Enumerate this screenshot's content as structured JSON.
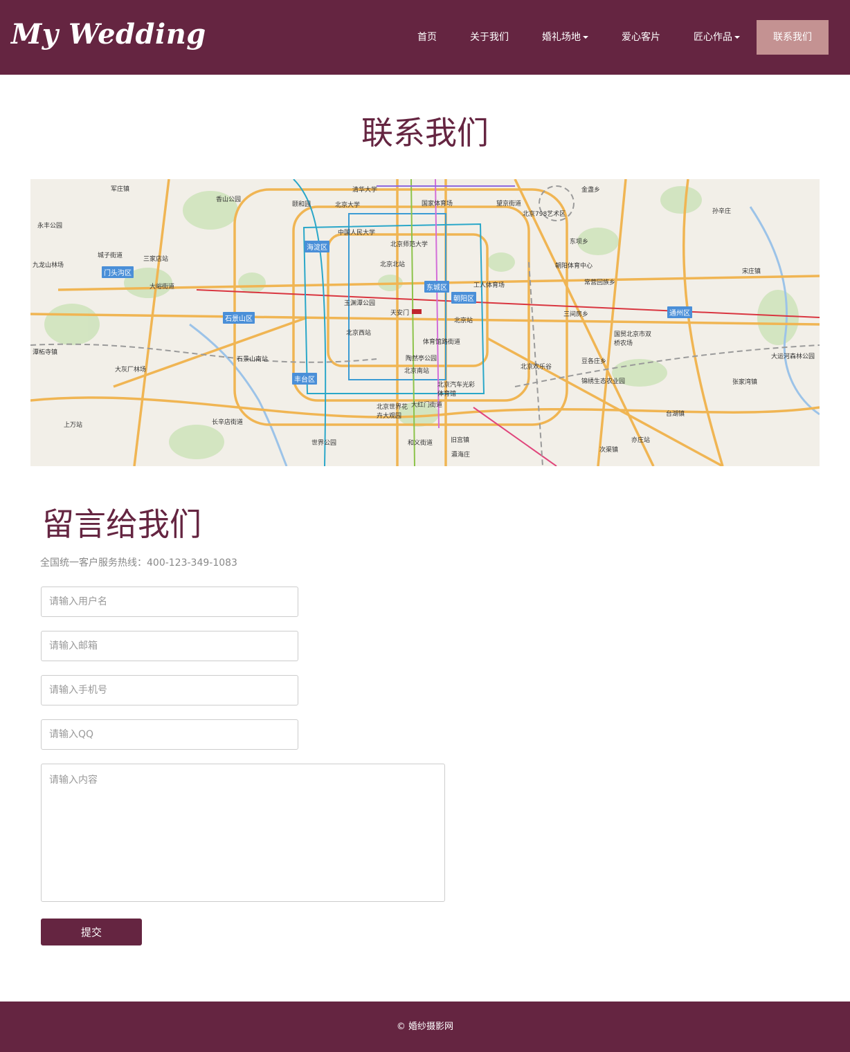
{
  "header": {
    "brand": "My Wedding",
    "nav": [
      {
        "label": "首页"
      },
      {
        "label": "关于我们"
      },
      {
        "label": "婚礼场地",
        "dropdown": true
      },
      {
        "label": "爱心客片"
      },
      {
        "label": "匠心作品",
        "dropdown": true
      },
      {
        "label": "联系我们",
        "active": true
      }
    ]
  },
  "contact": {
    "title": "联系我们"
  },
  "map": {
    "districts": [
      "海淀区",
      "门头沟区",
      "东城区",
      "朝阳区",
      "石景山区",
      "丰台区",
      "通州区"
    ],
    "places": [
      "军庄镇",
      "香山公园",
      "颐和园",
      "北京大学",
      "清华大学",
      "国家体育场",
      "望京街道",
      "北京798艺术区",
      "金盏乡",
      "孙辛庄",
      "永丰公园",
      "中国人民大学",
      "北京师范大学",
      "东坝乡",
      "九龙山林场",
      "城子街道",
      "三家店站",
      "北京北站",
      "朝阳体育中心",
      "宋庄镇",
      "大峪街道",
      "工人体育场",
      "常营回族乡",
      "玉渊潭公园",
      "天安门",
      "北京站",
      "三间房乡",
      "北京西站",
      "体育馆路街道",
      "国贸北京市双桥农场",
      "石景山南站",
      "陶然亭公园",
      "北京欢乐谷",
      "豆各庄乡",
      "大运河森林公园",
      "潭柘寺镇",
      "大灰厂林场",
      "北京南站",
      "北京汽车光彩体育馆",
      "锦绣生态农业园",
      "张家湾镇",
      "北京世界花卉大观园",
      "大红门街道",
      "台湖镇",
      "上万站",
      "长辛店街道",
      "世界公园",
      "和义街道",
      "旧宫镇",
      "亦庄站",
      "次渠镇",
      "瀛海庄"
    ]
  },
  "message": {
    "title": "留言给我们",
    "hotline": "全国统一客户服务热线：400-123-349-1083",
    "fields": {
      "username": "请输入用户名",
      "email": "请输入邮箱",
      "phone": "请输入手机号",
      "qq": "请输入QQ",
      "content": "请输入内容"
    },
    "submit": "提交"
  },
  "footer": {
    "copyright": "© 婚纱摄影网"
  },
  "colors": {
    "brand": "#652541",
    "nav_active": "#c49292",
    "map_district": "#4a8fd8"
  }
}
